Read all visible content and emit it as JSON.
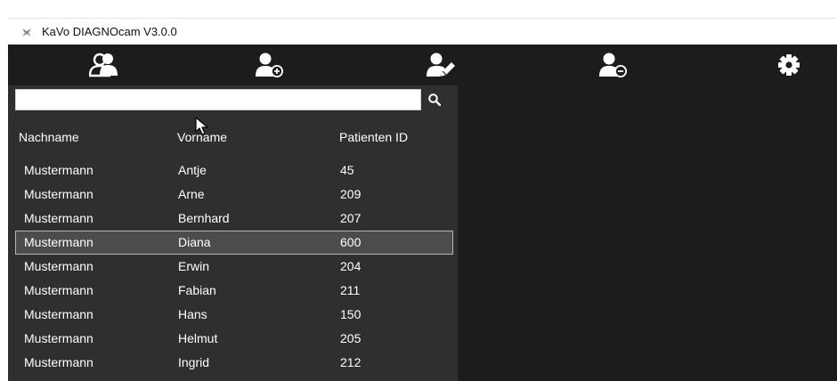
{
  "window": {
    "title": "KaVo DIAGNOcam V3.0.0",
    "icon": "kavo-app-icon"
  },
  "toolbar": {
    "buttons": [
      {
        "name": "patients",
        "icon": "patients-group-icon"
      },
      {
        "name": "add-patient",
        "icon": "user-add-icon"
      },
      {
        "name": "edit-patient",
        "icon": "user-edit-icon"
      },
      {
        "name": "delete-patient",
        "icon": "user-remove-icon"
      },
      {
        "name": "settings",
        "icon": "gear-icon"
      }
    ]
  },
  "search": {
    "value": "",
    "placeholder": "",
    "icon": "search-icon"
  },
  "table": {
    "columns": [
      "Nachname",
      "Vorname",
      "Patienten ID"
    ],
    "selected_index": 3,
    "rows": [
      {
        "last": "Mustermann",
        "first": "Antje",
        "id": "45"
      },
      {
        "last": "Mustermann",
        "first": "Arne",
        "id": "209"
      },
      {
        "last": "Mustermann",
        "first": "Bernhard",
        "id": "207"
      },
      {
        "last": "Mustermann",
        "first": "Diana",
        "id": "600"
      },
      {
        "last": "Mustermann",
        "first": "Erwin",
        "id": "204"
      },
      {
        "last": "Mustermann",
        "first": "Fabian",
        "id": "211"
      },
      {
        "last": "Mustermann",
        "first": "Hans",
        "id": "150"
      },
      {
        "last": "Mustermann",
        "first": "Helmut",
        "id": "205"
      },
      {
        "last": "Mustermann",
        "first": "Ingrid",
        "id": "212"
      }
    ]
  },
  "colors": {
    "toolbar_bg": "#1c1c1c",
    "list_bg": "#2f2f2f",
    "selected_row_bg": "#4c4c4c",
    "text": "#ffffff"
  }
}
